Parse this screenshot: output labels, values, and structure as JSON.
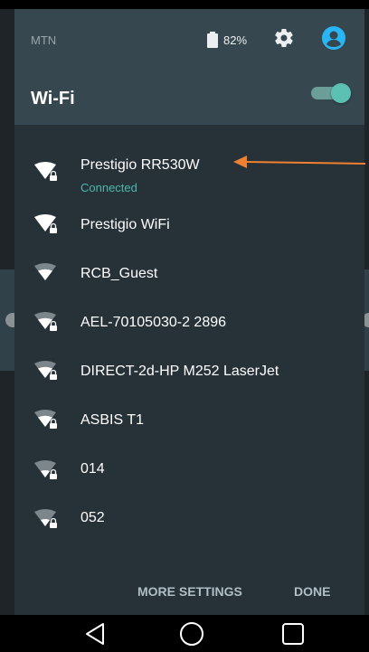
{
  "status_bar": {
    "carrier": "MTN",
    "battery": "82%"
  },
  "header": {
    "title": "Wi-Fi",
    "wifi_enabled": true
  },
  "networks": [
    {
      "name": "Prestigio RR530W",
      "status": "Connected",
      "secured": true,
      "signal": "full"
    },
    {
      "name": "Prestigio WiFi",
      "secured": true,
      "signal": "full"
    },
    {
      "name": "RCB_Guest",
      "secured": false,
      "signal": "medium"
    },
    {
      "name": "AEL-70105030-2 2896",
      "secured": true,
      "signal": "medium"
    },
    {
      "name": "DIRECT-2d-HP M252 LaserJet",
      "secured": true,
      "signal": "medium"
    },
    {
      "name": "ASBIS T1",
      "secured": true,
      "signal": "medium"
    },
    {
      "name": "014",
      "secured": true,
      "signal": "weak"
    },
    {
      "name": "052",
      "secured": true,
      "signal": "weak"
    }
  ],
  "footer": {
    "more_settings": "MORE SETTINGS",
    "done": "DONE"
  },
  "colors": {
    "header_bg": "#37474f",
    "body_bg": "#263238",
    "accent": "#4db6ac",
    "annotation_arrow": "#f08030"
  },
  "icons": {
    "wifi": "wifi-signal-icon",
    "lock": "lock-icon",
    "gear": "gear-icon",
    "user": "user-account-icon",
    "battery": "battery-icon",
    "back": "back-triangle-icon",
    "home": "home-circle-icon",
    "recents": "recents-square-icon"
  }
}
